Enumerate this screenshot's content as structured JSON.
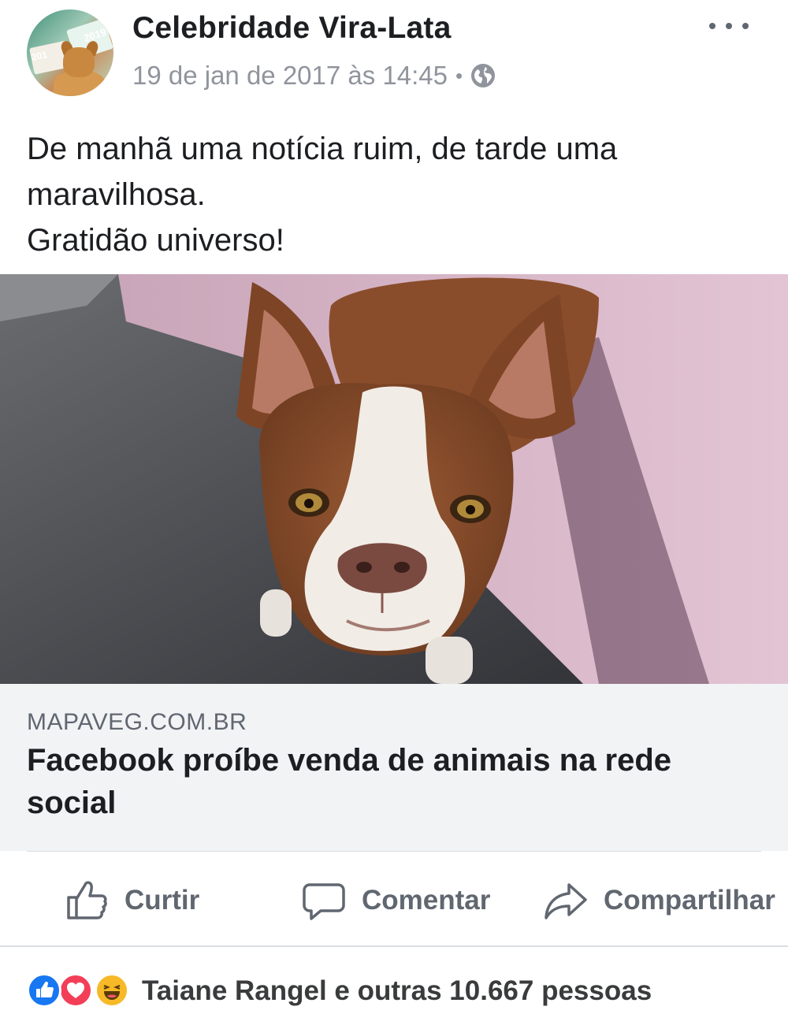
{
  "post": {
    "page_name": "Celebridade Vira-Lata",
    "timestamp": "19 de jan de 2017 às 14:45",
    "separator": "•",
    "privacy_icon": "globe-icon",
    "menu_icon": "more-options-icon",
    "text_lines": [
      "De manhã uma notícia ruim, de tarde uma",
      "maravilhosa.",
      "Gratidão universo!"
    ]
  },
  "link": {
    "domain": "MAPAVEG.COM.BR",
    "title": "Facebook proíbe venda de animais na rede social"
  },
  "actions": {
    "like_label": "Curtir",
    "comment_label": "Comentar",
    "share_label": "Compartilhar"
  },
  "reactions": {
    "types": [
      "like",
      "love",
      "haha"
    ],
    "summary": "Taiane Rangel e outras 10.667 pessoas"
  },
  "colors": {
    "text_primary": "#1c1e21",
    "text_secondary": "#90949c",
    "action_gray": "#606770",
    "link_bg": "#f2f3f5",
    "like_blue": "#1877f2",
    "love_red": "#f33e58",
    "haha_yellow": "#f7b928"
  }
}
